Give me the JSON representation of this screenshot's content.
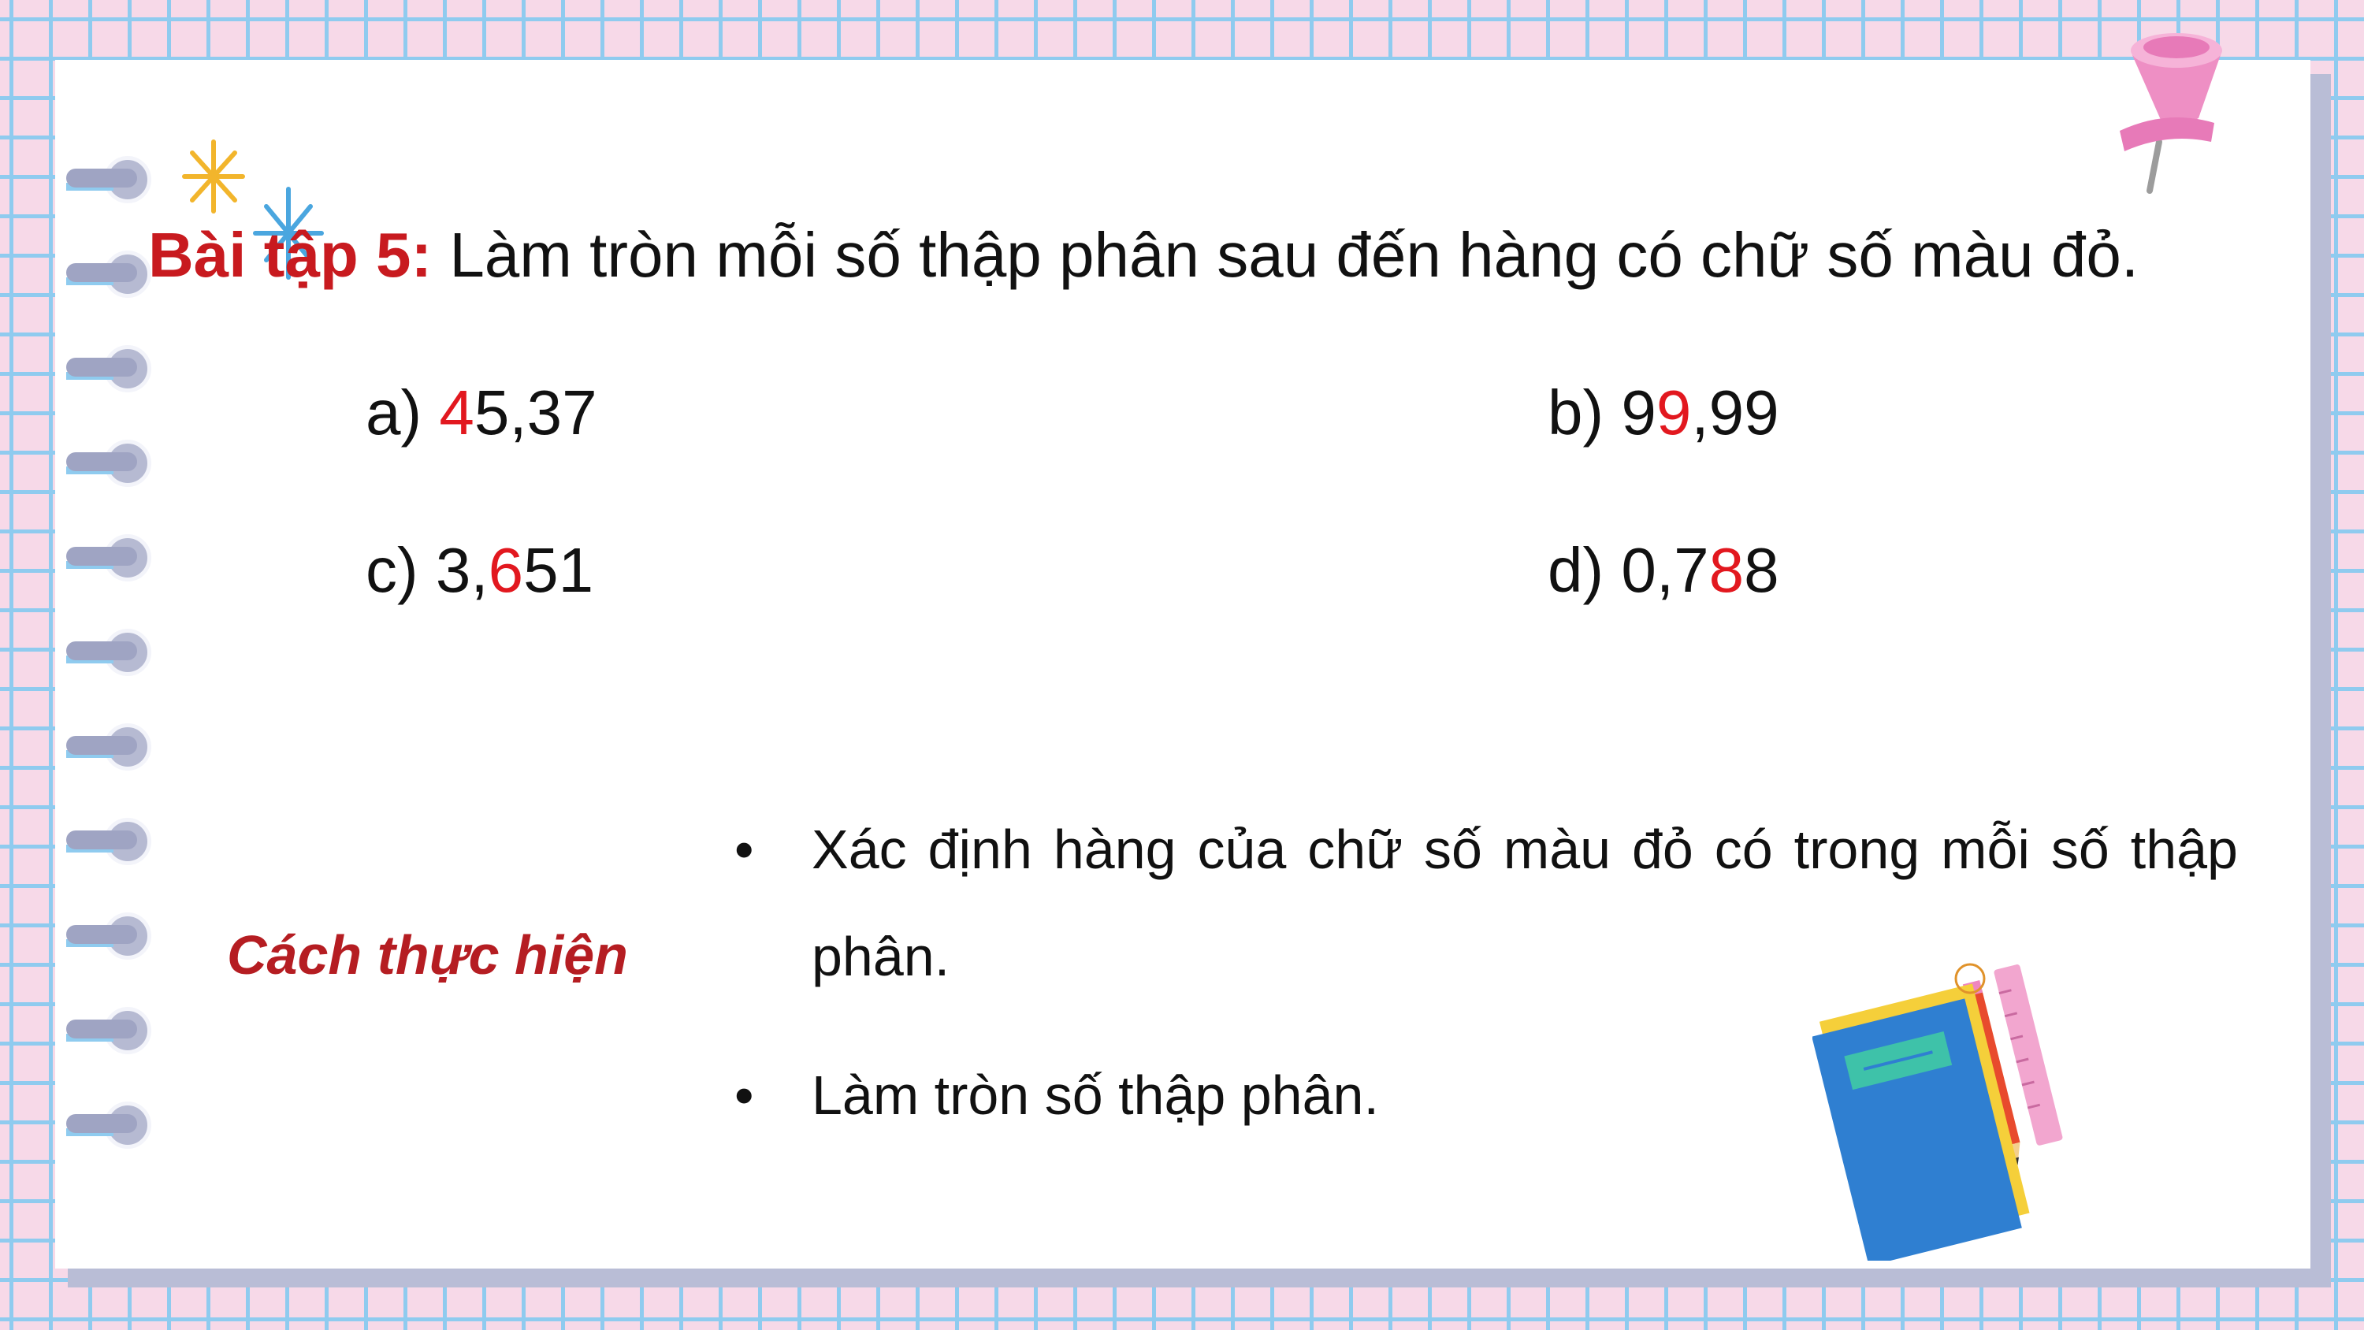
{
  "exercise": {
    "label": "Bài tập 5:",
    "instruction": "Làm tròn mỗi số thập phân sau đến hàng có chữ số màu đỏ."
  },
  "items": {
    "a": {
      "prefix": "a) ",
      "before": "",
      "red": "4",
      "after": "5,37"
    },
    "b": {
      "prefix": "b) ",
      "before": "9",
      "red": "9",
      "after": ",99"
    },
    "c": {
      "prefix": "c) ",
      "before": "3,",
      "red": "6",
      "after": "51"
    },
    "d": {
      "prefix": "d) ",
      "before": "0,7",
      "red": "8",
      "after": "8"
    }
  },
  "method": {
    "label": "Cách thực hiện",
    "bullet": "•",
    "steps": [
      "Xác định hàng của chữ số màu đỏ có trong mỗi số thập phân.",
      "Làm tròn số thập phân."
    ]
  },
  "colors": {
    "accent_red": "#e2181f",
    "label_red": "#c81a1f",
    "grid_blue": "#8fcbef",
    "background_pink": "#f7d9e8"
  },
  "icons": [
    "spiral-binding-rings",
    "sparkle-icon",
    "push-pin-icon",
    "books-pencil-ruler-icon"
  ]
}
